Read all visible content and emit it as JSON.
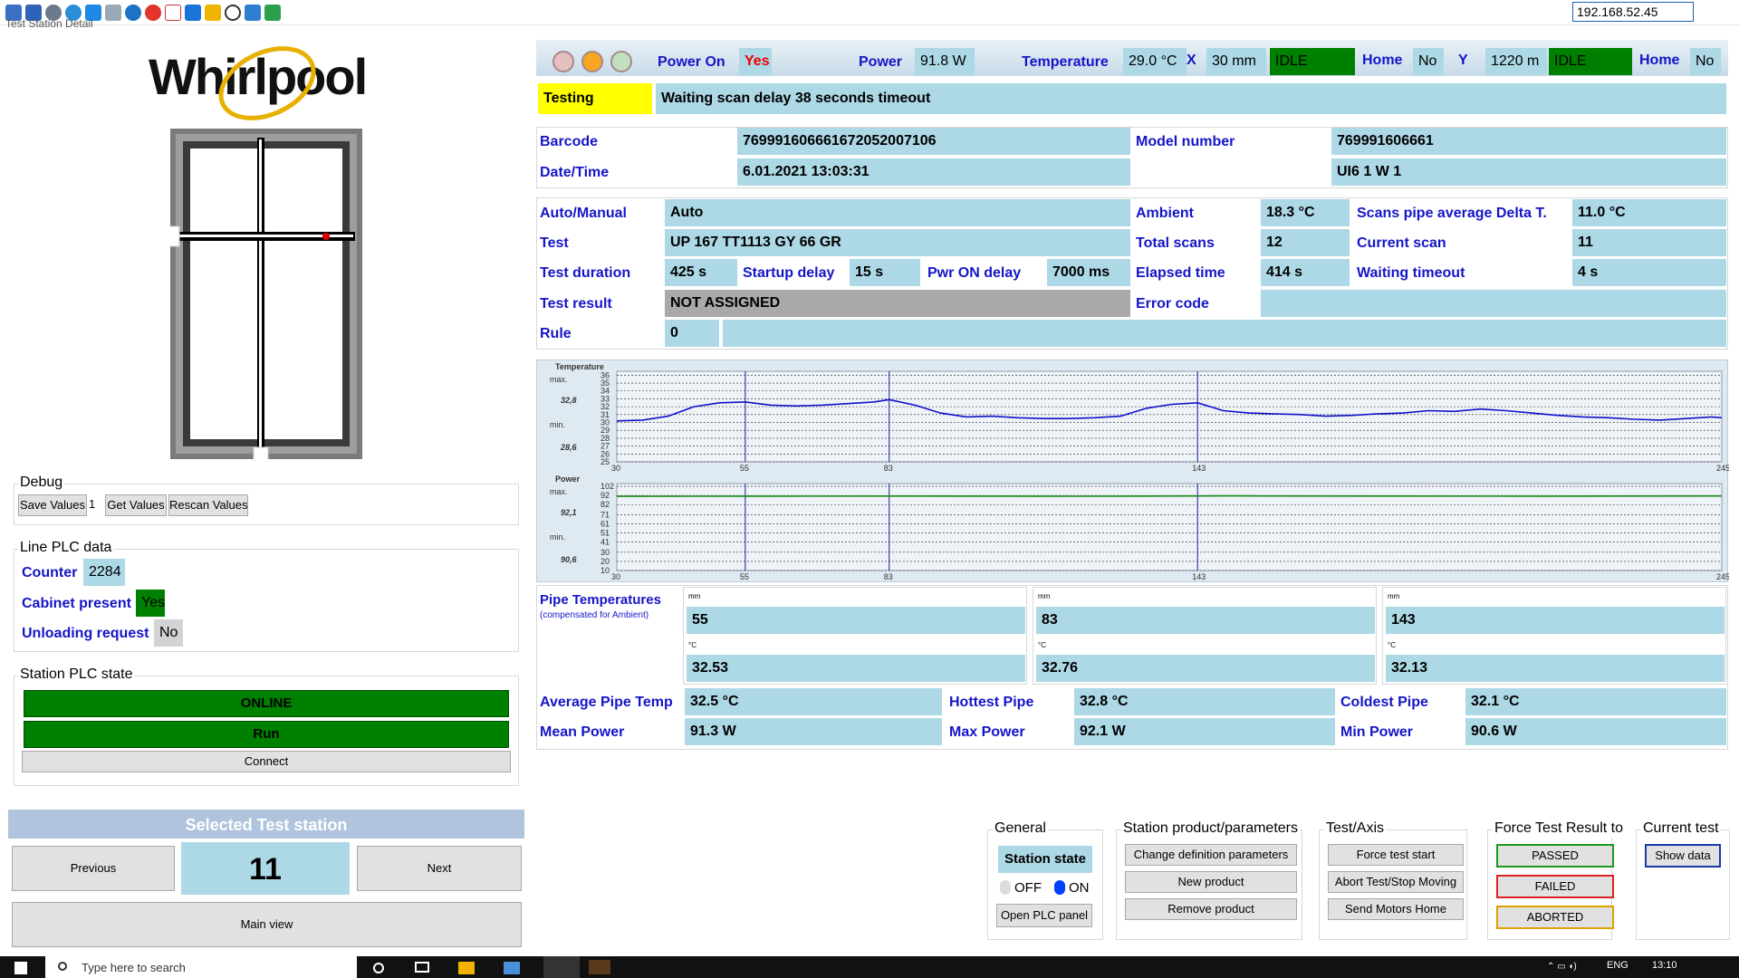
{
  "window": {
    "title": "Test Station Detail",
    "ip_address": "192.168.52.45"
  },
  "toolbar_icons": [
    "settings-icon",
    "screen-icon",
    "gear-icon",
    "refresh-icon",
    "windows-icon",
    "window-icon",
    "info-icon",
    "close-red-icon",
    "delete-doc-icon",
    "monitor-icon",
    "folder-icon",
    "crosshair-icon",
    "network-icon",
    "chat-icon"
  ],
  "brand": {
    "logo": "Whirlpool"
  },
  "debug": {
    "title": "Debug",
    "save_label": "Save Values",
    "value": "1",
    "get_label": "Get Values",
    "rescan_label": "Rescan Values"
  },
  "line_plc": {
    "title": "Line PLC data",
    "counter_label": "Counter",
    "counter_value": "2284",
    "cabinet_label": "Cabinet present",
    "cabinet_value": "Yes",
    "unloading_label": "Unloading request",
    "unloading_value": "No"
  },
  "station_plc": {
    "title": "Station PLC state",
    "online": "ONLINE",
    "run": "Run",
    "connect": "Connect"
  },
  "selected_station": {
    "title": "Selected Test station",
    "previous": "Previous",
    "number": "11",
    "next": "Next",
    "main_view": "Main view"
  },
  "status": {
    "power_on_label": "Power On",
    "power_on_value": "Yes",
    "power_label": "Power",
    "power_value": "91.8 W",
    "temperature_label": "Temperature",
    "temperature_value": "29.0 °C",
    "x_label": "X",
    "x_value": "30 mm",
    "x_state": "IDLE",
    "x_home_label": "Home",
    "x_home_value": "No",
    "y_label": "Y",
    "y_value": "1220 m",
    "y_state": "IDLE",
    "y_home_label": "Home",
    "y_home_value": "No",
    "testing_label": "Testing",
    "message": "Waiting scan delay 38 seconds timeout"
  },
  "product": {
    "barcode_label": "Barcode",
    "barcode_value": "769991606661672052007106",
    "datetime_label": "Date/Time",
    "datetime_value": "6.01.2021 13:03:31",
    "model_label": "Model number",
    "model_value": "769991606661",
    "variant_value": "UI6 1 W 1"
  },
  "test": {
    "auto_label": "Auto/Manual",
    "auto_value": "Auto",
    "test_label": "Test",
    "test_value": "UP 167 TT1113 GY 66 GR",
    "duration_label": "Test duration",
    "duration_value": "425 s",
    "startup_label": "Startup delay",
    "startup_value": "15 s",
    "pwron_label": "Pwr ON delay",
    "pwron_value": "7000 ms",
    "result_label": "Test result",
    "result_value": "NOT ASSIGNED",
    "rule_label": "Rule",
    "rule_value": "0",
    "rule_extra": "",
    "ambient_label": "Ambient",
    "ambient_value": "18.3 °C",
    "total_label": "Total scans",
    "total_value": "12",
    "elapsed_label": "Elapsed time",
    "elapsed_value": "414 s",
    "error_label": "Error code",
    "error_value": "",
    "delta_label": "Scans pipe average Delta T.",
    "delta_value": "11.0 °C",
    "current_label": "Current scan",
    "current_value": "11",
    "waiting_label": "Waiting timeout",
    "waiting_value": "4 s"
  },
  "chart_data": [
    {
      "type": "line",
      "title": "Temperature",
      "max_label": "max.",
      "max_value": "32,8",
      "min_label": "min.",
      "min_value": "28,6",
      "yticks": [
        25,
        26,
        27,
        28,
        29,
        30,
        31,
        32,
        33,
        34,
        35,
        36
      ],
      "ylim": [
        25,
        36.5
      ],
      "xlim": [
        30,
        245
      ],
      "xticks": [
        30,
        55,
        83,
        143,
        245
      ],
      "markers": [
        55,
        83,
        143
      ],
      "color": "#1010c8",
      "x": [
        30,
        35,
        40,
        45,
        50,
        55,
        60,
        65,
        70,
        75,
        80,
        83,
        88,
        93,
        98,
        103,
        108,
        113,
        118,
        123,
        128,
        133,
        138,
        143,
        148,
        153,
        158,
        163,
        168,
        173,
        178,
        183,
        188,
        193,
        198,
        203,
        208,
        213,
        218,
        223,
        228,
        233,
        238,
        243,
        245
      ],
      "y": [
        30.2,
        30.3,
        30.8,
        32.0,
        32.5,
        32.6,
        32.2,
        32.1,
        32.2,
        32.4,
        32.6,
        32.9,
        32.2,
        31.2,
        30.7,
        30.8,
        30.6,
        30.5,
        30.5,
        30.6,
        30.8,
        31.8,
        32.3,
        32.5,
        31.5,
        31.2,
        31.1,
        31.0,
        30.8,
        30.9,
        31.1,
        31.2,
        31.5,
        31.4,
        31.7,
        31.5,
        31.2,
        30.9,
        30.7,
        30.6,
        30.4,
        30.3,
        30.5,
        30.7,
        30.6
      ]
    },
    {
      "type": "line",
      "title": "Power",
      "max_label": "max.",
      "max_value": "92,1",
      "min_label": "min.",
      "min_value": "90,6",
      "yticks": [
        10,
        20,
        30,
        41,
        51,
        61,
        71,
        82,
        92,
        102
      ],
      "ylim": [
        10,
        105
      ],
      "xlim": [
        30,
        245
      ],
      "xticks": [
        30,
        55,
        83,
        143,
        245
      ],
      "markers": [
        55,
        83,
        143
      ],
      "color": "#1a8a1a",
      "x": [
        30,
        60,
        90,
        120,
        150,
        180,
        210,
        245
      ],
      "y": [
        91.0,
        91.2,
        91.3,
        91.1,
        91.5,
        91.3,
        91.2,
        91.4
      ]
    }
  ],
  "pipes": {
    "title": "Pipe Temperatures",
    "subtitle": "(compensated for Ambient)",
    "mm_unit": "mm",
    "c_unit": "°C",
    "items": [
      {
        "mm": "55",
        "temp": "32.53"
      },
      {
        "mm": "83",
        "temp": "32.76"
      },
      {
        "mm": "143",
        "temp": "32.13"
      }
    ]
  },
  "summary": {
    "avg_temp_label": "Average Pipe Temp",
    "avg_temp_value": "32.5 °C",
    "hottest_label": "Hottest Pipe",
    "hottest_value": "32.8 °C",
    "coldest_label": "Coldest Pipe",
    "coldest_value": "32.1 °C",
    "mean_power_label": "Mean Power",
    "mean_power_value": "91.3 W",
    "max_power_label": "Max Power",
    "max_power_value": "92.1 W",
    "min_power_label": "Min Power",
    "min_power_value": "90.6 W"
  },
  "general": {
    "title": "General",
    "station_state": "Station state",
    "off": "OFF",
    "on": "ON",
    "open_plc": "Open PLC panel"
  },
  "station_product": {
    "title": "Station product/parameters",
    "change": "Change definition parameters",
    "new": "New product",
    "remove": "Remove product"
  },
  "test_axis": {
    "title": "Test/Axis",
    "force_start": "Force test start",
    "abort": "Abort Test/Stop Moving",
    "send_home": "Send Motors Home"
  },
  "force_result": {
    "title": "Force Test Result to",
    "passed": "PASSED",
    "failed": "FAILED",
    "aborted": "ABORTED"
  },
  "current_test": {
    "title": "Current test",
    "show_data": "Show data"
  },
  "taskbar": {
    "search_placeholder": "Type here to search",
    "lang": "ENG",
    "time": "13:10"
  },
  "colors": {
    "accent_blue": "#1515c8",
    "value_bg": "#add8e6",
    "green": "#008000",
    "testing_yellow": "#ffff00"
  }
}
